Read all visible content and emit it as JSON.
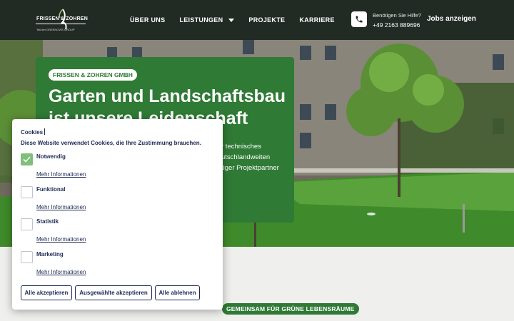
{
  "header": {
    "logo_text": "FRISSEN & ZOHREN",
    "logo_subtext": "Teil der GREENOVIS GROUP",
    "nav": [
      {
        "label": "ÜBER UNS"
      },
      {
        "label": "LEISTUNGEN"
      },
      {
        "label": "PROJEKTE"
      },
      {
        "label": "KARRIERE"
      }
    ],
    "help_question": "Benötigen Sie Hilfe?",
    "phone": "+49 2163 889696",
    "jobs_label": "Jobs anzeigen"
  },
  "hero": {
    "badge": "FRISSEN & ZOHREN GMBH",
    "headline": "Garten und Landschaftsbau ist unsere Leidenschaft",
    "text_line1": "r technisches",
    "text_line2": "utschlandweiten",
    "text_line3": "tiger Projektpartner"
  },
  "section_pill": "GEMEINSAM FÜR GRÜNE LEBENSRÄUME",
  "cookie": {
    "title": "Cookies",
    "description": "Diese Website verwendet Cookies, die Ihre Zustimmung brauchen.",
    "more_label": "Mehr Informationen",
    "options": [
      {
        "label": "Notwendig",
        "checked": true
      },
      {
        "label": "Funktional",
        "checked": false
      },
      {
        "label": "Statistik",
        "checked": false
      },
      {
        "label": "Marketing",
        "checked": false
      }
    ],
    "buttons": {
      "accept_all": "Alle akzeptieren",
      "accept_selected": "Ausgewählte akzeptieren",
      "reject_all": "Alle ablehnen"
    }
  },
  "colors": {
    "brand_green": "#2f7a35",
    "header_bg": "#222a24",
    "text_navy": "#1d2a55"
  }
}
